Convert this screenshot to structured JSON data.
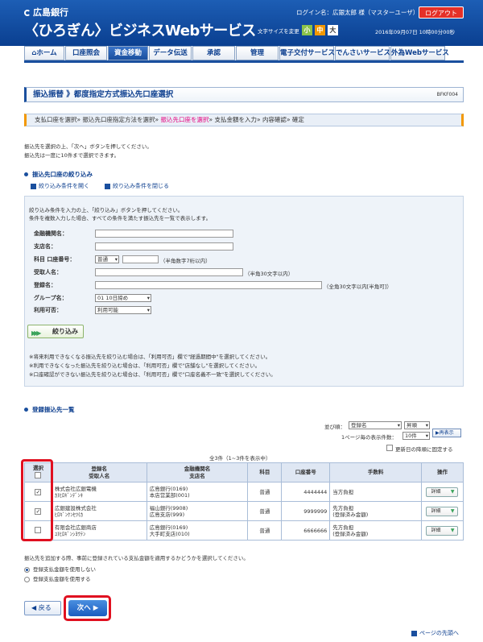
{
  "header": {
    "bank_name": "広島銀行",
    "service_name": "〈ひろぎん〉ビジネスWebサービス",
    "login_user": "ログイン名：広銀太郎 様（マスターユーザ）",
    "logout_label": "ログアウト",
    "font_size_label": "文字サイズを変更",
    "font_small": "小",
    "font_medium": "中",
    "font_large": "大",
    "datetime": "2016年09月07日 10時00分00秒"
  },
  "nav": {
    "items": [
      {
        "label": "ホーム"
      },
      {
        "label": "口座照会"
      },
      {
        "label": "資金移動"
      },
      {
        "label": "データ伝送"
      },
      {
        "label": "承認"
      },
      {
        "label": "管理"
      },
      {
        "label": "電子交付サービス"
      },
      {
        "label": "でんさいサービス"
      },
      {
        "label": "外為Webサービス"
      }
    ]
  },
  "page": {
    "title": "振込振替 》都度指定方式振込先口座選択",
    "screen_id": "BFKF004"
  },
  "steps": {
    "s1": "支払口座を選択",
    "s2": "振込先口座指定方法を選択",
    "s3": "振込先口座を選択",
    "s4": "支払金額を入力",
    "s5": "内容確認",
    "s6": "確定",
    "sep": "»"
  },
  "intro": {
    "line1": "振込先を選択の上、「次へ」ボタンを押してください。",
    "line2": "振込先は一度に10件まで選択できます。"
  },
  "filter": {
    "heading": "振込先口座の絞り込み",
    "open_link": "絞り込み条件を開く",
    "close_link": "絞り込み条件を閉じる",
    "desc1": "絞り込み条件を入力の上、「絞り込み」ボタンを押してください。",
    "desc2": "条件を複数入力した場合、すべての条件を満たす振込先を一覧で表示します。",
    "fields": {
      "bank_label": "金融機関名：",
      "branch_label": "支店名：",
      "account_label": "科目 口座番号：",
      "account_type": "普通",
      "account_hint": "（半角数字7桁以内）",
      "payee_label": "受取人名：",
      "payee_hint": "（半角30文字以内）",
      "reg_label": "登録名：",
      "reg_hint": "（全角30文字以内[半角可]）",
      "group_label": "グループ名：",
      "group_value": "01 10日締め",
      "avail_label": "利用可否：",
      "avail_value": "利用可能"
    },
    "button": "絞り込み",
    "note1": "※将来利用できなくなる振込先を絞り込む場合は、「利用可否」欄で\"経過期間中\"を選択してください。",
    "note2": "※利用できなくなった振込先を絞り込む場合は、「利用可否」欄で\"店舗なし\"を選択してください。",
    "note3": "※口座確認ができない振込先を絞り込む場合は、「利用可否」欄で\"口座名義不一致\"を選択してください。"
  },
  "list": {
    "heading": "登録振込先一覧",
    "sort_label": "並び順：",
    "sort_value": "登録名",
    "order_value": "昇順",
    "rerender": "再表示",
    "per_page_label": "1ページ毎の表示件数：",
    "per_page_value": "10件",
    "fix_label": "更新日の降順に固定する",
    "count_text": "全3件（1~3件を表示中）",
    "headers": {
      "select": "選択",
      "reg_name": "登録名",
      "payee": "受取人名",
      "bank": "金融機関名",
      "branch": "支店名",
      "type": "科目",
      "acct": "口座番号",
      "fee": "手数料",
      "op": "操作"
    },
    "rows": [
      {
        "checked": "✓",
        "reg": "株式会社広銀電機",
        "kana": "ｶ)ﾋﾛｷﾞﾝﾃﾞﾝｷ",
        "bank": "広島銀行(0169)",
        "branch": "本店営業部(001)",
        "type": "普通",
        "acct": "4444444",
        "fee1": "当方負担",
        "fee2": "",
        "detail": "詳細"
      },
      {
        "checked": "✓",
        "reg": "広銀建設株式会社",
        "kana": "ﾋﾛｷﾞﾝｹﾝｾﾂ(ｶ",
        "bank": "福山銀行(9908)",
        "branch": "広島支店(999)",
        "type": "普通",
        "acct": "9999999",
        "fee1": "先方負担",
        "fee2": "(登録済み金額)",
        "detail": "詳細"
      },
      {
        "checked": "",
        "reg": "有限会社広銀商店",
        "kana": "ﾕ)ﾋﾛｷﾞﾝｼﾖｳﾃﾝ",
        "bank": "広島銀行(0169)",
        "branch": "大手町支店(010)",
        "type": "普通",
        "acct": "6666666",
        "fee1": "先方負担",
        "fee2": "(登録済み金額)",
        "detail": "詳細"
      }
    ]
  },
  "after": {
    "question": "振込先を追加する際、事前に登録されている支払金額を適用するかどうかを選択してください。",
    "opt1": "登録支払金額を使用しない",
    "opt2": "登録支払金額を使用する"
  },
  "footer": {
    "back": "戻る",
    "next": "次へ",
    "page_top": "ページの先頭へ"
  }
}
